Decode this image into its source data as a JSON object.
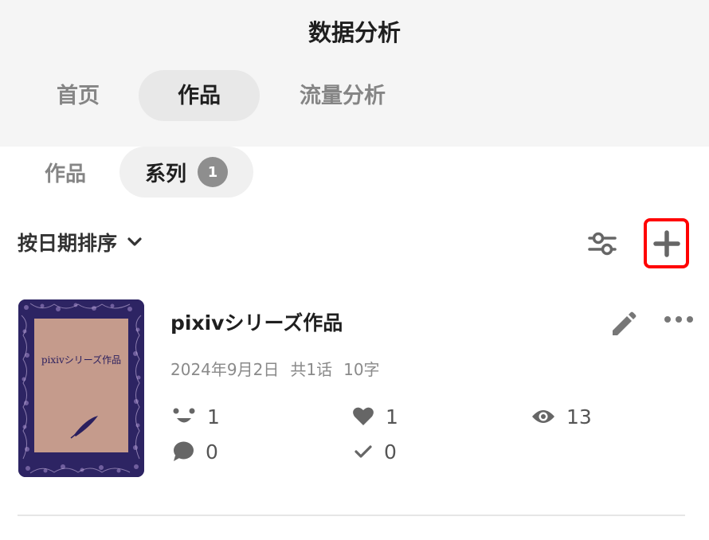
{
  "header": {
    "title": "数据分析",
    "tabs": [
      {
        "label": "首页",
        "active": false
      },
      {
        "label": "作品",
        "active": true
      },
      {
        "label": "流量分析",
        "active": false
      }
    ]
  },
  "subtabs": [
    {
      "label": "作品",
      "active": false
    },
    {
      "label": "系列",
      "active": true,
      "badge": "1"
    }
  ],
  "toolbar": {
    "sort_label": "按日期排序",
    "sort_icon": "chevron-down-icon",
    "filter_icon": "sliders-icon",
    "add_icon": "plus-icon",
    "highlight_color": "#ff0000"
  },
  "series": [
    {
      "title": "pixivシリーズ作品",
      "cover_text": "pixivシリーズ作品",
      "date": "2024年9月2日",
      "episodes": "共1话",
      "chars": "10字",
      "edit_icon": "pencil-icon",
      "more_icon": "more-horizontal-icon",
      "stats": {
        "reactions": "1",
        "likes": "1",
        "views": "13",
        "comments": "0",
        "checks": "0"
      }
    }
  ],
  "colors": {
    "header_bg": "#f5f5f5",
    "active_tab_bg": "#e8e8e8",
    "inactive_text": "#858585",
    "cover_frame": "#2a1f5e",
    "cover_paper": "#c59b8c"
  }
}
